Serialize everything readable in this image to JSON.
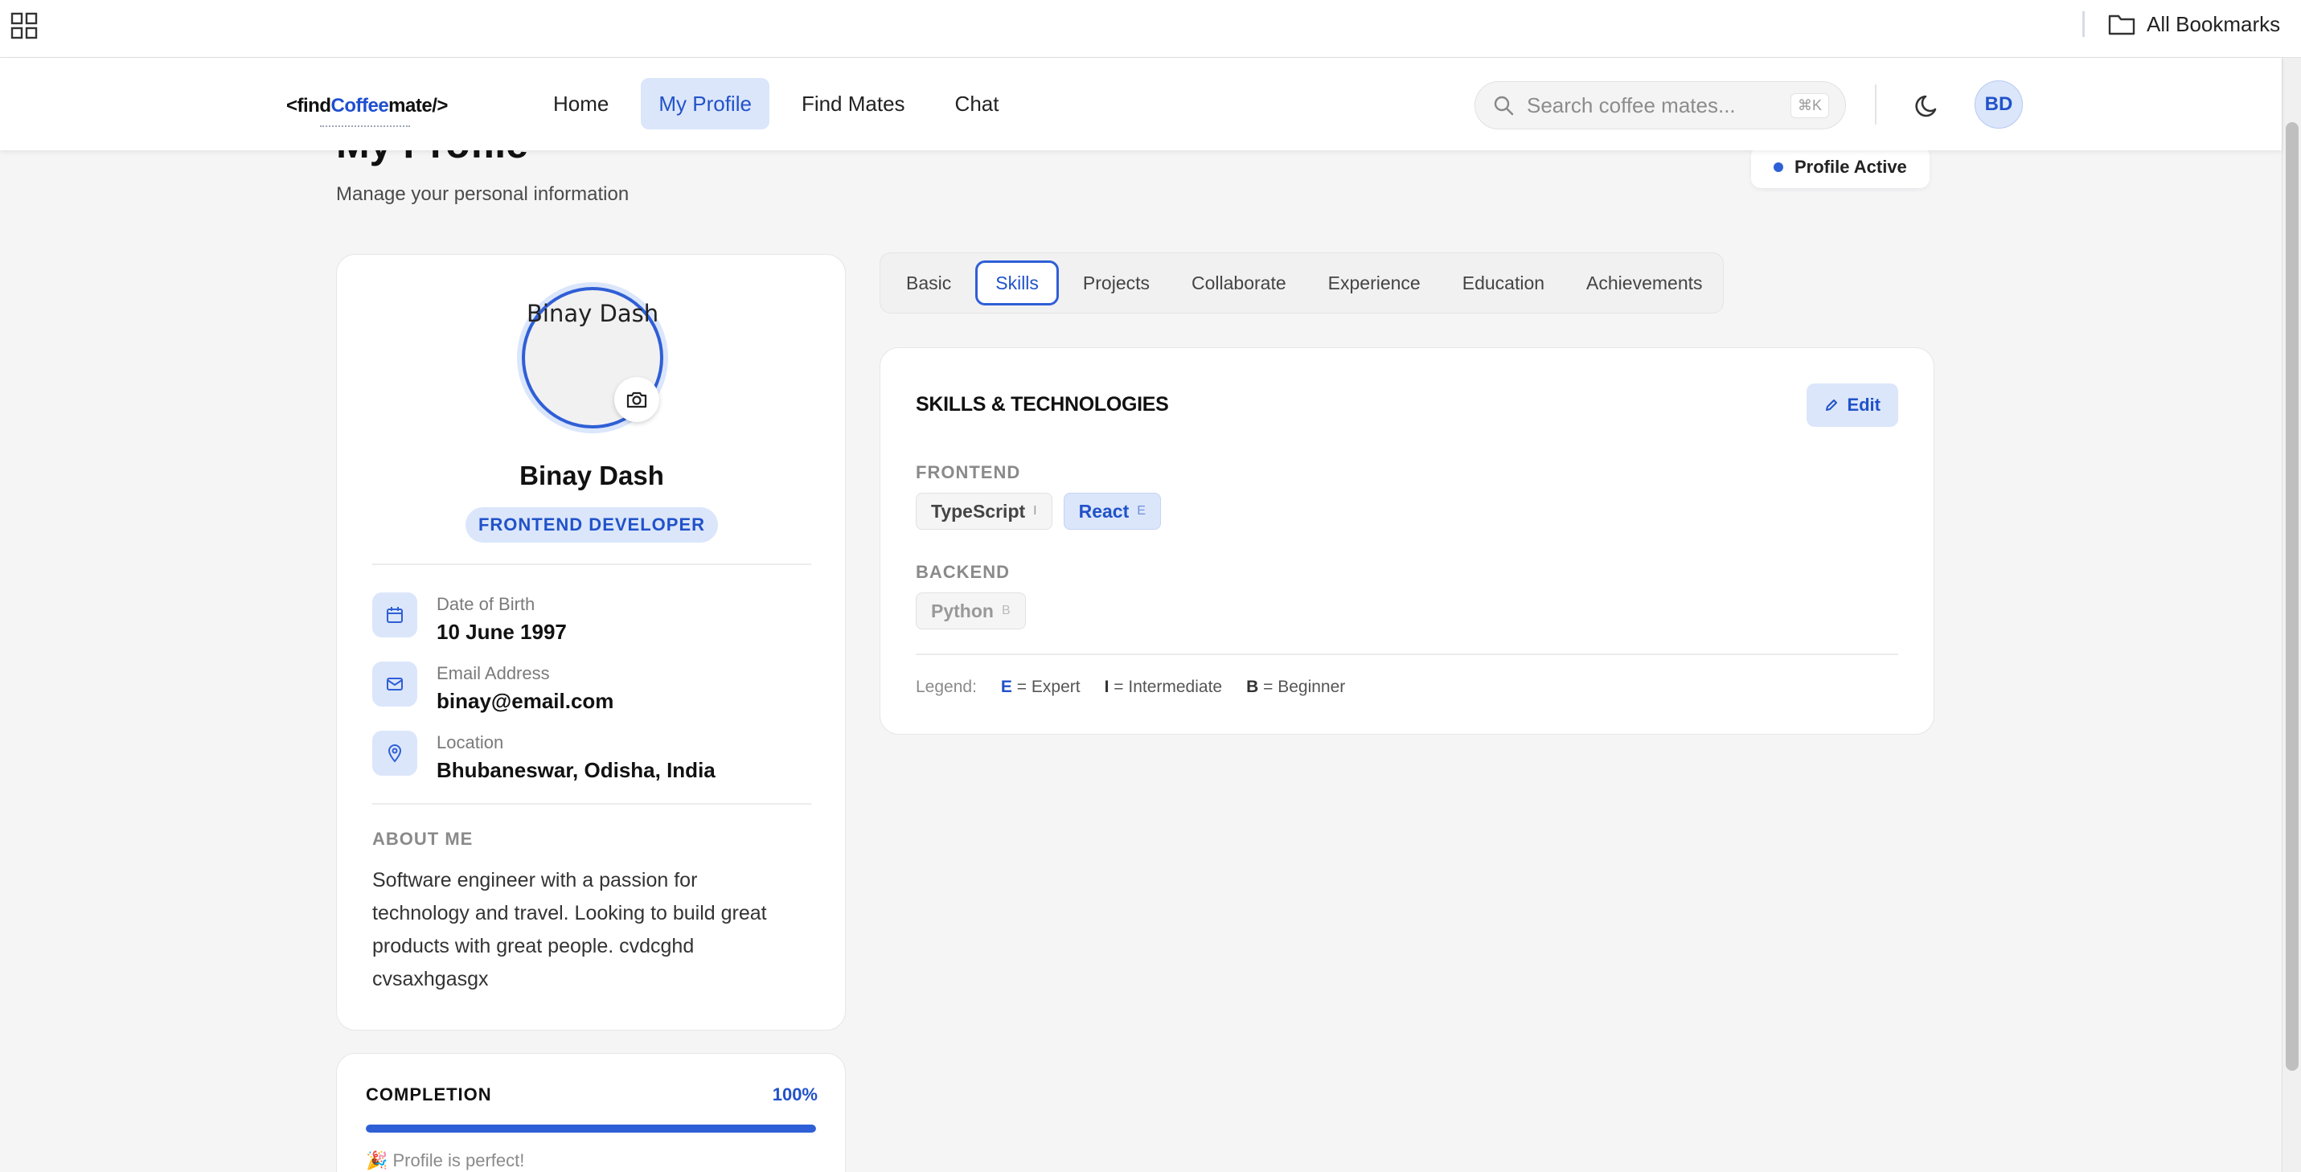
{
  "browser": {
    "bookmarks_label": "All Bookmarks"
  },
  "header": {
    "logo_prefix": "<find",
    "logo_coffee": "Coffee",
    "logo_suffix": "mate/>",
    "nav": [
      {
        "label": "Home",
        "active": false
      },
      {
        "label": "My Profile",
        "active": true
      },
      {
        "label": "Find Mates",
        "active": false
      },
      {
        "label": "Chat",
        "active": false
      }
    ],
    "search_placeholder": "Search coffee mates...",
    "search_shortcut": "⌘K",
    "avatar_initials": "BD"
  },
  "page": {
    "title": "My Profile",
    "subtitle": "Manage your personal information",
    "status": "Profile Active"
  },
  "profile": {
    "photo_alt": "Binay Dash",
    "name": "Binay Dash",
    "role": "FRONTEND DEVELOPER",
    "dob_label": "Date of Birth",
    "dob": "10 June 1997",
    "email_label": "Email Address",
    "email": "binay@email.com",
    "location_label": "Location",
    "location": "Bhubaneswar, Odisha, India",
    "about_heading": "ABOUT ME",
    "about": "Software engineer with a passion for technology and travel. Looking to build great products with great people. cvdcghd cvsaxhgasgx"
  },
  "completion": {
    "heading": "COMPLETION",
    "percent_label": "100%",
    "percent": 100,
    "message": "🎉 Profile is perfect!"
  },
  "tabs": [
    {
      "label": "Basic",
      "active": false
    },
    {
      "label": "Skills",
      "active": true
    },
    {
      "label": "Projects",
      "active": false
    },
    {
      "label": "Collaborate",
      "active": false
    },
    {
      "label": "Experience",
      "active": false
    },
    {
      "label": "Education",
      "active": false
    },
    {
      "label": "Achievements",
      "active": false
    }
  ],
  "skills": {
    "heading": "SKILLS & TECHNOLOGIES",
    "edit_label": "Edit",
    "categories": [
      {
        "name": "FRONTEND",
        "items": [
          {
            "name": "TypeScript",
            "level": "I"
          },
          {
            "name": "React",
            "level": "E"
          }
        ]
      },
      {
        "name": "BACKEND",
        "items": [
          {
            "name": "Python",
            "level": "B"
          }
        ]
      }
    ],
    "legend": {
      "label": "Legend:",
      "entries": [
        {
          "key": "E",
          "text": "= Expert"
        },
        {
          "key": "I",
          "text": "= Intermediate"
        },
        {
          "key": "B",
          "text": "= Beginner"
        }
      ]
    }
  },
  "colors": {
    "accent": "#2f5fd6",
    "accent_light": "#dbe6fb",
    "background": "#f5f5f6"
  }
}
